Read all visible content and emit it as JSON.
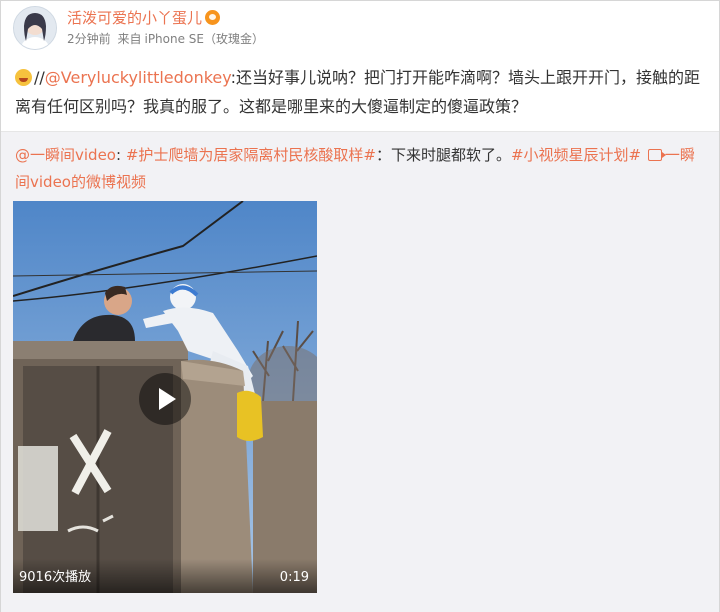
{
  "post": {
    "author": "活泼可爱的小丫蛋儿",
    "time": "2分钟前",
    "source_prefix": "来自",
    "device": "iPhone SE（玫瑰金）",
    "text_prefix": "//",
    "mention": "@Veryluckylittledonkey",
    "text": ":还当好事儿说呐？把门打开能咋滴啊？墙头上跟开开门，接触的距离有任何区别吗？我真的服了。这都是哪里来的大傻逼制定的傻逼政策？"
  },
  "repost": {
    "author": "@一瞬间video",
    "colon": ": ",
    "topic1": "#护士爬墙为居家隔离村民核酸取样#",
    "text": "：下来时腿都软了。",
    "topic2": "#小视频星辰计划#",
    "video_link": "一瞬间video的微博视频"
  },
  "video": {
    "play_count": "9016次播放",
    "duration": "0:19"
  },
  "colors": {
    "accent": "#eb7350",
    "repost_bg": "#f2f2f5",
    "meta": "#808080"
  },
  "icons": [
    "avatar",
    "vip-badge-icon",
    "laughing-emoji-icon",
    "video-link-icon",
    "play-icon"
  ]
}
